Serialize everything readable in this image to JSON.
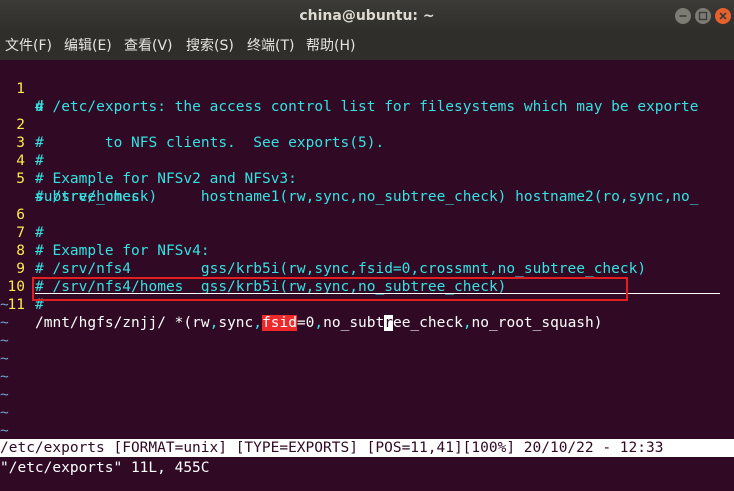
{
  "window": {
    "title": "china@ubuntu: ~",
    "buttons": {
      "minimize_icon": "minimize-icon",
      "maximize_icon": "maximize-icon",
      "close_icon": "close-icon"
    }
  },
  "menu": {
    "items": [
      "文件(F)",
      "编辑(E)",
      "查看(V)",
      "搜索(S)",
      "终端(T)",
      "帮助(H)"
    ]
  },
  "editor": {
    "lines": [
      {
        "num": "1",
        "text": "# /etc/exports: the access control list for filesystems which may be exporte"
      },
      {
        "num": "",
        "text": "d"
      },
      {
        "num": "2",
        "text": "#       to NFS clients.  See exports(5)."
      },
      {
        "num": "3",
        "text": "#"
      },
      {
        "num": "4",
        "text": "# Example for NFSv2 and NFSv3:"
      },
      {
        "num": "5",
        "text": "# /srv/homes       hostname1(rw,sync,no_subtree_check) hostname2(ro,sync,no_"
      },
      {
        "num": "",
        "text": "subtree_check)"
      },
      {
        "num": "6",
        "text": "#"
      },
      {
        "num": "7",
        "text": "# Example for NFSv4:"
      },
      {
        "num": "8",
        "text": "# /srv/nfs4        gss/krb5i(rw,sync,fsid=0,crossmnt,no_subtree_check)"
      },
      {
        "num": "9",
        "text": "# /srv/nfs4/homes  gss/krb5i(rw,sync,no_subtree_check)"
      },
      {
        "num": "10",
        "text": "#"
      }
    ],
    "current_line": {
      "num": "11",
      "part1": "/mnt/hgfs/znjj/ *(rw",
      "comma1": ",",
      "part2": "sync",
      "comma2": ",",
      "highlight": "fsid",
      "part3": "=0",
      "comma3": ",",
      "part4": "no_subt",
      "cursor_char": "r",
      "part5": "ee_check",
      "comma4": ",",
      "part6": "no_root_squash)"
    },
    "tilde": "~"
  },
  "status": {
    "statusline": "/etc/exports [FORMAT=unix] [TYPE=EXPORTS] [POS=11,41][100%] 20/10/22 - 12:33",
    "message": "\"/etc/exports\" 11L, 455C"
  }
}
